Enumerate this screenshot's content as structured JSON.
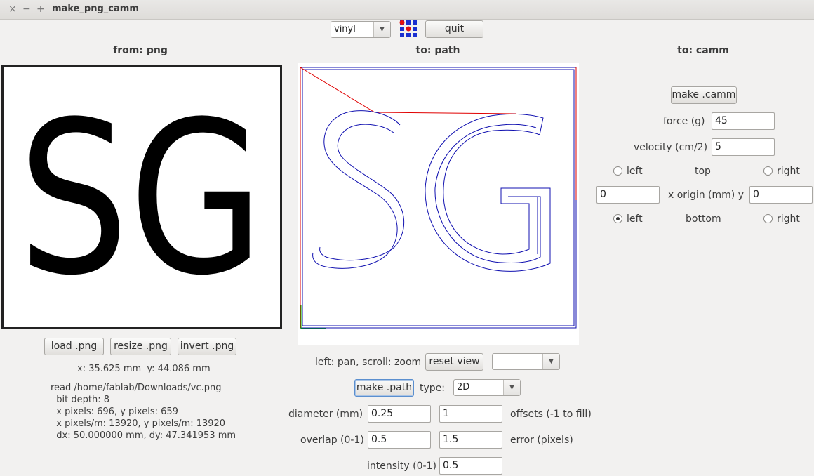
{
  "window": {
    "title": "make_png_camm",
    "close_glyph": "×",
    "minimize_glyph": "−",
    "maximize_glyph": "+"
  },
  "toolbar": {
    "machine_select": "vinyl",
    "quit_label": "quit",
    "logo_icon": "grid-logo-icon"
  },
  "png_panel": {
    "heading": "from: png",
    "image_text": "SG",
    "load_label": "load .png",
    "resize_label": "resize .png",
    "invert_label": "invert .png",
    "coords": "x: 35.625 mm  y: 44.086 mm",
    "info": [
      "read /home/fablab/Downloads/vc.png",
      "  bit depth: 8",
      "  x pixels: 696, y pixels: 659",
      "  x pixels/m: 13920, y pixels/m: 13920",
      "  dx: 50.000000 mm, dy: 47.341953 mm"
    ]
  },
  "path_panel": {
    "heading": "to: path",
    "hint": "left: pan, scroll: zoom",
    "reset_label": "reset view",
    "view_select": "",
    "make_path_label": "make .path",
    "type_label": "type:",
    "type_value": "2D",
    "diameter_label": "diameter (mm)",
    "diameter_value": "0.25",
    "offsets_value": "1",
    "offsets_label": "offsets (-1 to fill)",
    "overlap_label": "overlap (0-1)",
    "overlap_value": "0.5",
    "error_value": "1.5",
    "error_label": "error (pixels)",
    "intensity_label": "intensity (0-1)",
    "intensity_value": "0.5",
    "colors": {
      "path": "#1010b0",
      "move": "#e00000",
      "axis_x": "#00b000"
    }
  },
  "camm_panel": {
    "heading": "to: camm",
    "make_camm_label": "make .camm",
    "force_label": "force (g)",
    "force_value": "45",
    "velocity_label": "velocity (cm/2)",
    "velocity_value": "5",
    "left_label": "left",
    "top_label": "top",
    "right_label": "right",
    "origin_x_value": "0",
    "origin_label": "x  origin (mm)  y",
    "origin_y_value": "0",
    "left2_label": "left",
    "bottom_label": "bottom",
    "right2_label": "right",
    "selected_origin": "bottom-left"
  }
}
